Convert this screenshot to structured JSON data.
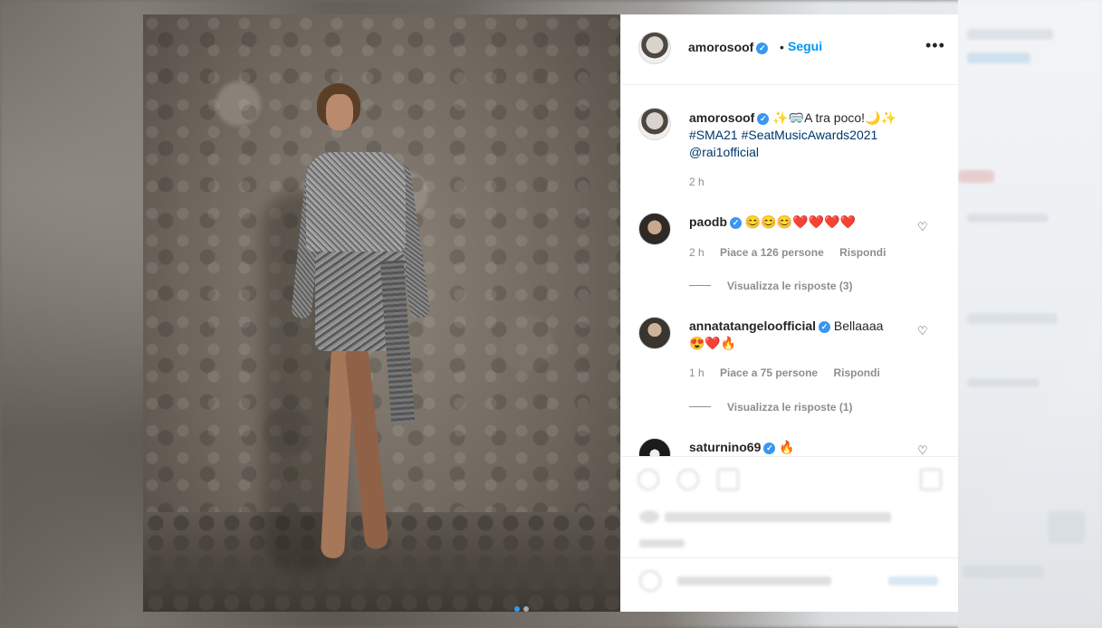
{
  "post": {
    "author": "amorosoof",
    "verified_badge": "✓",
    "follow_separator": "•",
    "follow_label": "Segui",
    "more_label": "•••",
    "carousel": {
      "count": 2,
      "active": 0
    }
  },
  "caption": {
    "username": "amorosoof",
    "text": "✨🥽A tra poco!🌙✨",
    "hashtags": "#SMA21 #SeatMusicAwards2021",
    "mention": "@rai1official",
    "time": "2 h"
  },
  "comments": [
    {
      "username": "paodb",
      "text": "😊😊😊❤️❤️❤️❤️",
      "time": "2 h",
      "likes": "Piace a 126 persone",
      "reply": "Rispondi",
      "view_replies": "Visualizza le risposte (3)"
    },
    {
      "username": "annatatangeloofficial",
      "text": "Bellaaaa",
      "text2": "😍❤️🔥",
      "time": "1 h",
      "likes": "Piace a 75 persone",
      "reply": "Rispondi",
      "view_replies": "Visualizza le risposte (1)"
    },
    {
      "username": "saturnino69",
      "text": "🔥"
    }
  ],
  "icons": {
    "heart": "♡",
    "next_arrow": "›"
  }
}
